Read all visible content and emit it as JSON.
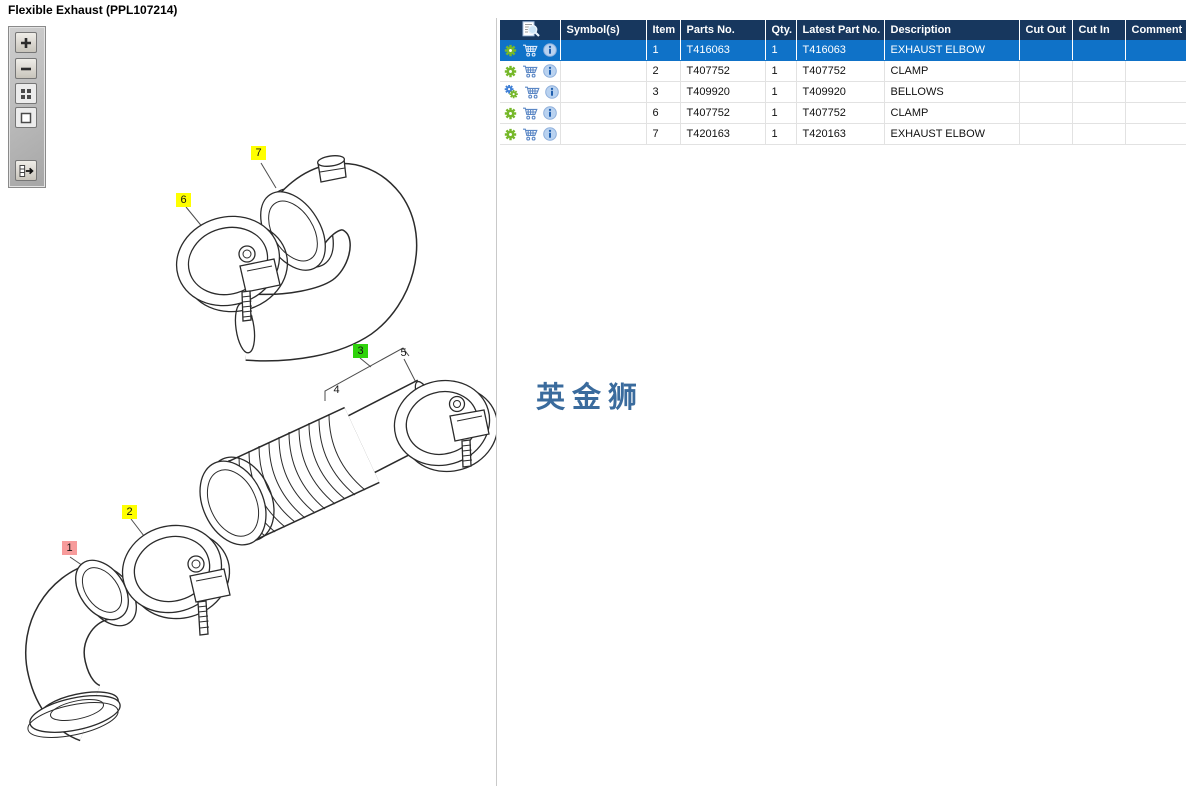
{
  "title": "Flexible Exhaust (PPL107214)",
  "watermark": "英金狮",
  "toolbar": {
    "buttons": [
      {
        "name": "zoom-in",
        "icon": "plus-icon"
      },
      {
        "name": "zoom-out",
        "icon": "minus-icon"
      },
      {
        "name": "thumbnail-view",
        "icon": "grid-icon"
      },
      {
        "name": "fit-view",
        "icon": "square-icon"
      },
      {
        "name": "toggle-parts-list",
        "icon": "list-arrow-icon"
      }
    ]
  },
  "diagram": {
    "callouts": [
      {
        "label": "1",
        "highlight": "pink"
      },
      {
        "label": "2",
        "highlight": "yellow"
      },
      {
        "label": "3",
        "highlight": "green"
      },
      {
        "label": "4",
        "highlight": "none"
      },
      {
        "label": "5",
        "highlight": "none"
      },
      {
        "label": "6",
        "highlight": "yellow"
      },
      {
        "label": "7",
        "highlight": "yellow"
      }
    ]
  },
  "table": {
    "columns": [
      "",
      "Symbol(s)",
      "Item",
      "Parts No.",
      "Qty.",
      "Latest Part No.",
      "Description",
      "Cut Out",
      "Cut In",
      "Comment"
    ],
    "rows": [
      {
        "icons": [
          "gear-icon",
          "cart-icon",
          "info-icon"
        ],
        "symbols": "",
        "item": "1",
        "parts_no": "T416063",
        "qty": "1",
        "latest_part_no": "T416063",
        "description": "EXHAUST ELBOW",
        "cut_out": "",
        "cut_in": "",
        "comment": "",
        "selected": true
      },
      {
        "icons": [
          "gear-icon",
          "cart-icon",
          "info-icon"
        ],
        "symbols": "",
        "item": "2",
        "parts_no": "T407752",
        "qty": "1",
        "latest_part_no": "T407752",
        "description": "CLAMP",
        "cut_out": "",
        "cut_in": "",
        "comment": "",
        "selected": false
      },
      {
        "icons": [
          "double-gear-icon",
          "cart-icon",
          "info-icon"
        ],
        "symbols": "",
        "item": "3",
        "parts_no": "T409920",
        "qty": "1",
        "latest_part_no": "T409920",
        "description": "BELLOWS",
        "cut_out": "",
        "cut_in": "",
        "comment": "",
        "selected": false
      },
      {
        "icons": [
          "gear-icon",
          "cart-icon",
          "info-icon"
        ],
        "symbols": "",
        "item": "6",
        "parts_no": "T407752",
        "qty": "1",
        "latest_part_no": "T407752",
        "description": "CLAMP",
        "cut_out": "",
        "cut_in": "",
        "comment": "",
        "selected": false
      },
      {
        "icons": [
          "gear-icon",
          "cart-icon",
          "info-icon"
        ],
        "symbols": "",
        "item": "7",
        "parts_no": "T420163",
        "qty": "1",
        "latest_part_no": "T420163",
        "description": "EXHAUST ELBOW",
        "cut_out": "",
        "cut_in": "",
        "comment": "",
        "selected": false
      }
    ]
  },
  "colors": {
    "header_bg": "#17375E",
    "selected_row_bg": "#0F72C8",
    "callout_yellow": "#FFFF00",
    "callout_green": "#2FD30B",
    "callout_pink": "#F79B9B",
    "watermark_blue": "#3A6B9D",
    "gear_green": "#76B82A",
    "gear_blue": "#3E7FD6",
    "cart_blue": "#5B87C5",
    "info_blue": "#1F5FAF"
  }
}
